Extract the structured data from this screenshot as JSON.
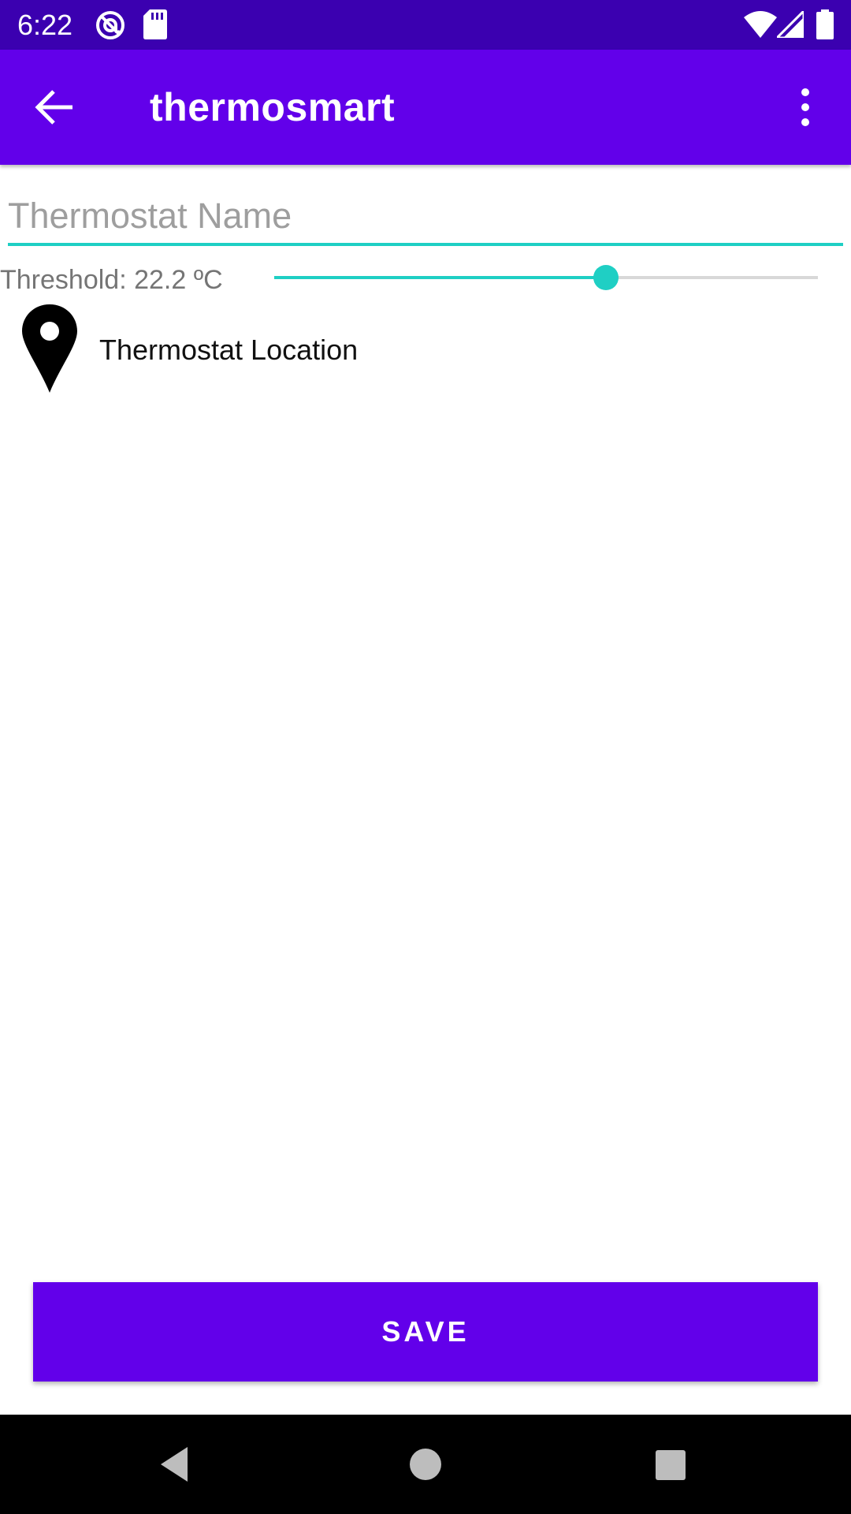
{
  "status_bar": {
    "time": "6:22",
    "left_icons": [
      "at-sign-icon",
      "sd-card-icon"
    ],
    "right_icons": [
      "wifi-icon",
      "cell-signal-icon",
      "battery-icon"
    ]
  },
  "app_bar": {
    "title": "thermosmart",
    "back_icon": "arrow-back-icon",
    "menu_icon": "more-vertical-icon"
  },
  "form": {
    "name_placeholder": "Thermostat Name",
    "name_value": "",
    "threshold_label": "Threshold: 22.2 ºC",
    "threshold_fraction": 0.61,
    "location_icon": "map-pin-icon",
    "location_label": "Thermostat Location"
  },
  "save_label": "SAVE",
  "colors": {
    "status_bar": "#3b00b0",
    "primary": "#6200ea",
    "accent": "#1fcfc4"
  },
  "nav_bar": {
    "buttons": [
      "back-triangle-icon",
      "home-circle-icon",
      "recents-square-icon"
    ]
  }
}
